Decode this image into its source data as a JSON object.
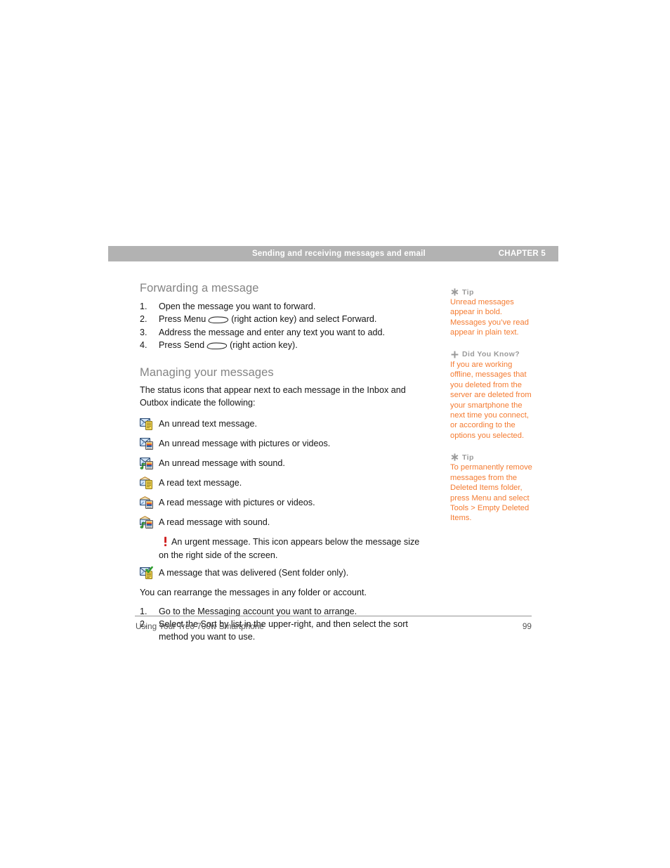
{
  "header": {
    "title": "Sending and receiving messages and email",
    "chapter": "CHAPTER 5",
    "bar_color": "#b2b2b2"
  },
  "main": {
    "section1": {
      "heading": "Forwarding a message",
      "steps": [
        {
          "num": "1.",
          "text_before": "Open the message you want to forward.",
          "key": false,
          "text_after": ""
        },
        {
          "num": "2.",
          "text_before": "Press Menu",
          "key": true,
          "text_after": "(right action key) and select Forward."
        },
        {
          "num": "3.",
          "text_before": "Address the message and enter any text you want to add.",
          "key": false,
          "text_after": ""
        },
        {
          "num": "4.",
          "text_before": "Press Send",
          "key": true,
          "text_after": "(right action key)."
        }
      ]
    },
    "section2": {
      "heading": "Managing your messages",
      "intro": "The status icons that appear next to each message in the Inbox and Outbox indicate the following:",
      "icon_items": [
        {
          "icon": "unread-text-message-icon",
          "label": "An unread text message."
        },
        {
          "icon": "unread-picture-message-icon",
          "label": "An unread message with pictures or videos."
        },
        {
          "icon": "unread-sound-message-icon",
          "label": "An unread message with sound."
        },
        {
          "icon": "read-text-message-icon",
          "label": "A read text message."
        },
        {
          "icon": "read-picture-message-icon",
          "label": "A read message with pictures or videos."
        },
        {
          "icon": "read-sound-message-icon",
          "label": "A read message with sound."
        }
      ],
      "urgent": {
        "icon": "urgent-message-icon",
        "label": "An urgent message. This icon appears below the message size on the right side of the screen."
      },
      "delivered": {
        "icon": "delivered-message-icon",
        "label": "A message that was delivered (Sent folder only)."
      },
      "after_list": "You can rearrange the messages in any folder or account.",
      "bottom_steps": [
        {
          "num": "1.",
          "text": "Go to the Messaging account you want to arrange."
        },
        {
          "num": "2.",
          "text": "Select the Sort by list in the upper-right, and then select the sort method you want to use."
        }
      ]
    }
  },
  "sidebar": {
    "accent_color": "#f47b31",
    "label_color": "#9a9a9a",
    "blocks": [
      {
        "icon": "asterisk-icon",
        "label": "Tip",
        "body": "Unread messages appear in bold. Messages you’ve read appear in plain text."
      },
      {
        "icon": "plus-icon",
        "label": "Did You Know?",
        "body": "If you are working offline, messages that you deleted from the server are deleted from your smartphone the next time you connect, or according to the options you selected."
      },
      {
        "icon": "asterisk-icon",
        "label": "Tip",
        "body": "To permanently remove messages from the Deleted Items folder, press Menu and select Tools > Empty Deleted Items."
      }
    ]
  },
  "footer": {
    "left": "Using Your Treo 700w Smartphone",
    "right": "99"
  }
}
